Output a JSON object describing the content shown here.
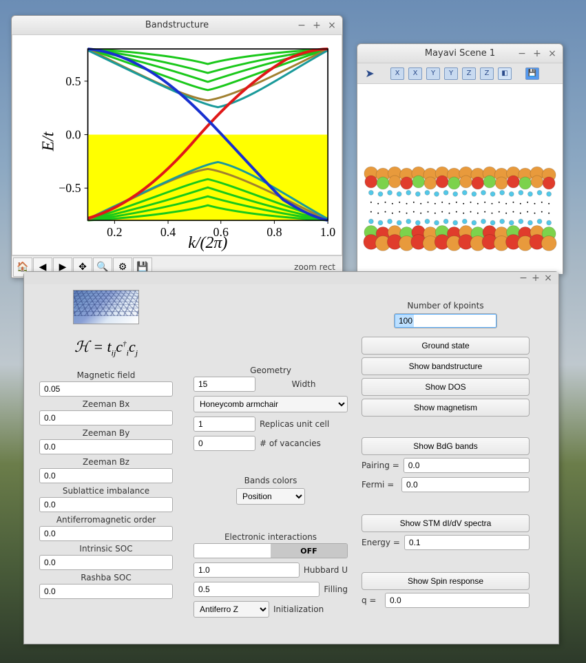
{
  "windows": {
    "bandstructure": {
      "title": "Bandstructure",
      "toolbar_status": "zoom rect",
      "tools": [
        "home",
        "back",
        "forward",
        "pan",
        "zoom",
        "configure",
        "save"
      ]
    },
    "mayavi": {
      "title": "Mayavi Scene 1",
      "tools": [
        "X",
        "X",
        "Y",
        "Y",
        "Z",
        "Z"
      ]
    }
  },
  "chart_data": {
    "type": "line",
    "title": "Bandstructure",
    "xlabel": "k/(2π)",
    "ylabel": "E/t",
    "xlim": [
      0.1,
      1.0
    ],
    "ylim": [
      -0.8,
      0.8
    ],
    "x_ticks": [
      0.2,
      0.4,
      0.6,
      0.8,
      1.0
    ],
    "y_ticks": [
      -0.5,
      0.0,
      0.5
    ],
    "filled_region": {
      "ymin": -0.8,
      "ymax": 0.0,
      "color": "yellow"
    },
    "note": "Dense band structure with many green bulk bands and one red and one blue edge-state band crossing near k≈0.5, E≈0. Values below are approximate interpolated points.",
    "series": [
      {
        "name": "edge-red",
        "color": "#e22",
        "x": [
          0.1,
          0.2,
          0.3,
          0.4,
          0.5,
          0.6,
          0.7,
          0.8,
          0.9,
          1.0
        ],
        "values": [
          -0.78,
          -0.7,
          -0.48,
          -0.18,
          0.1,
          0.32,
          0.53,
          0.7,
          0.78,
          0.8
        ]
      },
      {
        "name": "edge-blue",
        "color": "#23d",
        "x": [
          0.1,
          0.2,
          0.3,
          0.4,
          0.5,
          0.6,
          0.7,
          0.8,
          0.9,
          1.0
        ],
        "values": [
          0.8,
          0.78,
          0.7,
          0.55,
          0.32,
          0.05,
          -0.25,
          -0.53,
          -0.72,
          -0.8
        ]
      },
      {
        "name": "bulk-upper-1",
        "color": "#2c2",
        "x": [
          0.1,
          0.3,
          0.5,
          0.7,
          0.9,
          1.0
        ],
        "values": [
          0.8,
          0.62,
          0.46,
          0.52,
          0.73,
          0.8
        ]
      },
      {
        "name": "bulk-upper-2",
        "color": "#2c2",
        "x": [
          0.1,
          0.3,
          0.5,
          0.7,
          0.9,
          1.0
        ],
        "values": [
          0.8,
          0.7,
          0.55,
          0.6,
          0.77,
          0.8
        ]
      },
      {
        "name": "bulk-upper-3",
        "color": "#2c2",
        "x": [
          0.1,
          0.3,
          0.5,
          0.7,
          0.9,
          1.0
        ],
        "values": [
          0.8,
          0.77,
          0.65,
          0.7,
          0.79,
          0.8
        ]
      },
      {
        "name": "bulk-lower-1",
        "color": "#2c2",
        "x": [
          0.1,
          0.3,
          0.5,
          0.7,
          0.9,
          1.0
        ],
        "values": [
          -0.8,
          -0.62,
          -0.46,
          -0.52,
          -0.73,
          -0.8
        ]
      },
      {
        "name": "bulk-lower-2",
        "color": "#2c2",
        "x": [
          0.1,
          0.3,
          0.5,
          0.7,
          0.9,
          1.0
        ],
        "values": [
          -0.8,
          -0.7,
          -0.55,
          -0.6,
          -0.77,
          -0.8
        ]
      },
      {
        "name": "bulk-lower-3",
        "color": "#2c2",
        "x": [
          0.1,
          0.3,
          0.5,
          0.7,
          0.9,
          1.0
        ],
        "values": [
          -0.8,
          -0.77,
          -0.65,
          -0.7,
          -0.79,
          -0.8
        ]
      }
    ]
  },
  "form": {
    "hamiltonian_label": "ℋ = t",
    "hamiltonian_sub": "ij",
    "hamiltonian_c1": "c",
    "hamiltonian_dag": "†",
    "hamiltonian_i": "i",
    "hamiltonian_c2": "c",
    "hamiltonian_j": "j",
    "left": {
      "magnetic_field_label": "Magnetic field",
      "magnetic_field": "0.05",
      "zeeman_bx_label": "Zeeman Bx",
      "zeeman_bx": "0.0",
      "zeeman_by_label": "Zeeman By",
      "zeeman_by": "0.0",
      "zeeman_bz_label": "Zeeman Bz",
      "zeeman_bz": "0.0",
      "sublattice_label": "Sublattice imbalance",
      "sublattice": "0.0",
      "afm_label": "Antiferromagnetic order",
      "afm": "0.0",
      "intrinsic_soc_label": "Intrinsic SOC",
      "intrinsic_soc": "0.0",
      "rashba_soc_label": "Rashba SOC",
      "rashba_soc": "0.0"
    },
    "mid": {
      "geometry_label": "Geometry",
      "width": "15",
      "width_label": "Width",
      "lattice": "Honeycomb armchair",
      "replicas": "1",
      "replicas_label": "Replicas unit cell",
      "vacancies": "0",
      "vacancies_label": "# of vacancies",
      "bands_colors_label": "Bands colors",
      "bands_colors": "Position",
      "interactions_label": "Electronic interactions",
      "interactions_toggle": "OFF",
      "hubbard": "1.0",
      "hubbard_label": "Hubbard U",
      "filling": "0.5",
      "filling_label": "Filling",
      "initialization": "Antiferro Z",
      "initialization_label": "Initialization"
    },
    "right": {
      "kpoints_label": "Number of kpoints",
      "kpoints": "100",
      "ground_state": "Ground state",
      "show_bands": "Show bandstructure",
      "show_dos": "Show DOS",
      "show_magnetism": "Show magnetism",
      "show_bdg": "Show BdG bands",
      "pairing_label": "Pairing =",
      "pairing": "0.0",
      "fermi_label": "Fermi =",
      "fermi": "0.0",
      "show_stm": "Show STM dI/dV spectra",
      "energy_label": "Energy =",
      "energy": "0.1",
      "show_spin": "Show Spin response",
      "q_label": "q =",
      "q": "0.0"
    }
  }
}
